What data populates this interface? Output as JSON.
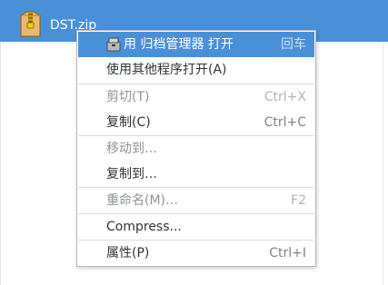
{
  "file": {
    "name": "DST.zip",
    "icon": "zip-archive-icon"
  },
  "menu": {
    "items": [
      {
        "label": "用 归档管理器 打开",
        "accel": "回车",
        "icon": "archive-manager-icon",
        "state": "highlighted"
      },
      {
        "label": "使用其他程序打开(A)",
        "accel": "",
        "state": "enabled"
      },
      {
        "label": "剪切(T)",
        "accel": "Ctrl+X",
        "state": "disabled"
      },
      {
        "label": "复制(C)",
        "accel": "Ctrl+C",
        "state": "enabled"
      },
      {
        "label": "移动到…",
        "accel": "",
        "state": "disabled"
      },
      {
        "label": "复制到…",
        "accel": "",
        "state": "enabled"
      },
      {
        "label": "重命名(M)…",
        "accel": "F2",
        "state": "disabled"
      },
      {
        "label": "Compress...",
        "accel": "",
        "state": "enabled"
      },
      {
        "label": "属性(P)",
        "accel": "Ctrl+I",
        "state": "enabled"
      }
    ]
  },
  "colors": {
    "selection": "#4a90d9",
    "menu_background": "#ffffff",
    "disabled_text": "#8e9292"
  }
}
